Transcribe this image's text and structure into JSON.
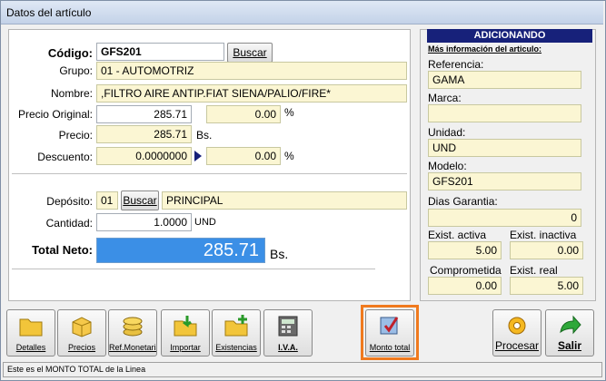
{
  "window": {
    "title": "Datos del artículo"
  },
  "form": {
    "codigo_label": "Código:",
    "codigo_value": "GFS201",
    "buscar_label": "Buscar",
    "grupo_label": "Grupo:",
    "grupo_value": "01 - AUTOMOTRIZ",
    "nombre_label": "Nombre:",
    "nombre_value": ",FILTRO AIRE ANTIP.FIAT SIENA/PALIO/FIRE*",
    "precio_original_label": "Precio Original:",
    "precio_original_value": "285.71",
    "precio_original_pct": "0.00",
    "percent_sign": "%",
    "precio_label": "Precio:",
    "precio_value": "285.71",
    "currency_short": "Bs.",
    "descuento_label": "Descuento:",
    "descuento_value": "0.0000000",
    "descuento_pct": "0.00",
    "deposito_label": "Depósito:",
    "deposito_code": "01",
    "deposito_buscar_label": "Buscar",
    "deposito_name": "PRINCIPAL",
    "cantidad_label": "Cantidad:",
    "cantidad_value": "1.0000",
    "cantidad_unit": "UND",
    "total_label": "Total Neto:",
    "total_value": "285.71",
    "total_currency": "Bs."
  },
  "side": {
    "header": "ADICIONANDO",
    "subtitle": "Más información del articulo:",
    "referencia_label": "Referencia:",
    "referencia_value": "GAMA",
    "marca_label": "Marca:",
    "marca_value": "",
    "unidad_label": "Unidad:",
    "unidad_value": "UND",
    "modelo_label": "Modelo:",
    "modelo_value": "GFS201",
    "garantia_label": "Dias Garantia:",
    "garantia_value": "0",
    "exist_activa_label": "Exist. activa",
    "exist_activa_value": "5.00",
    "exist_inactiva_label": "Exist. inactiva",
    "exist_inactiva_value": "0.00",
    "comprometida_label": "Comprometida",
    "comprometida_value": "0.00",
    "exist_real_label": "Exist. real",
    "exist_real_value": "5.00"
  },
  "toolbar": {
    "detalles": "Detalles",
    "precios": "Precios",
    "ref_monetaria": "Ref.Monetaria",
    "importar": "Importar",
    "existencias": "Existencias",
    "iva": "I.V.A.",
    "monto_total": "Monto total",
    "procesar": "Procesar",
    "salir": "Salir"
  },
  "status": {
    "text": "Este es el MONTO TOTAL de la Linea"
  },
  "colors": {
    "highlight": "#f07a1e",
    "total_bg": "#3b8fe6",
    "header_bg": "#17217a",
    "field_bg": "#fbf6d3"
  }
}
